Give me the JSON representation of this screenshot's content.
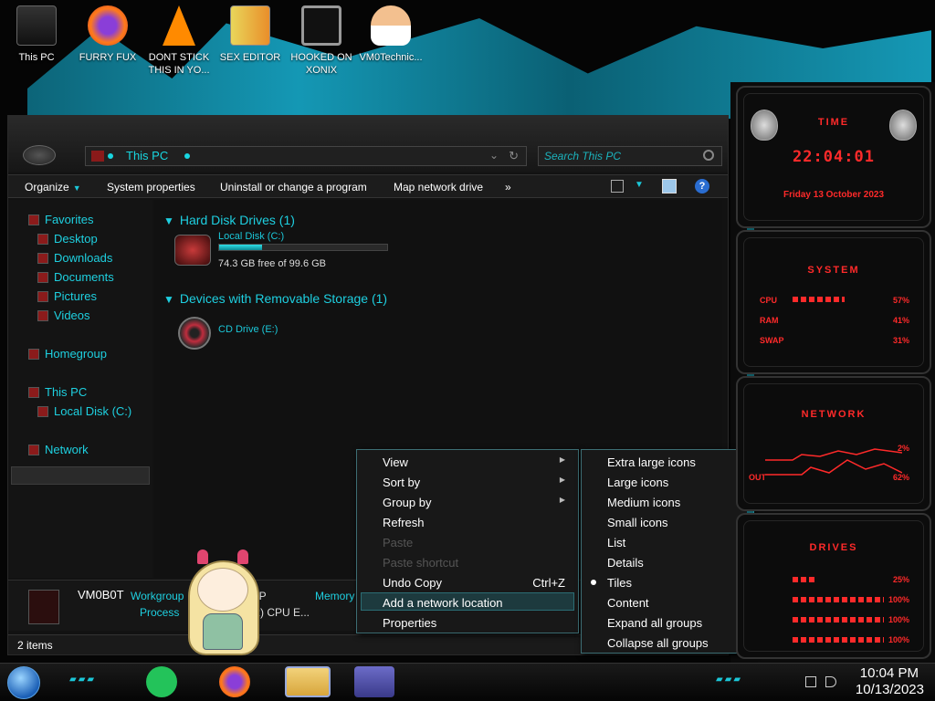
{
  "desktop_icons": [
    {
      "label": "This PC",
      "icon": "computer-icon"
    },
    {
      "label": "FURRY FUX",
      "icon": "firefox-icon"
    },
    {
      "label": "DONT STICK THIS IN YO...",
      "icon": "vlc-icon"
    },
    {
      "label": "SEX EDITOR",
      "icon": "hex-editor-icon"
    },
    {
      "label": "HOOKED ON XONIX",
      "icon": "xonix-game-icon"
    },
    {
      "label": "VM0Technic...",
      "icon": "doctor-icon"
    }
  ],
  "explorer": {
    "address": "This PC",
    "search_placeholder": "Search This PC",
    "toolbar": {
      "organize": "Organize",
      "system_properties": "System properties",
      "uninstall": "Uninstall or change a program",
      "map_drive": "Map network drive",
      "more": "»"
    },
    "nav": {
      "favorites": "Favorites",
      "desktop": "Desktop",
      "downloads": "Downloads",
      "documents": "Documents",
      "pictures": "Pictures",
      "videos": "Videos",
      "homegroup": "Homegroup",
      "this_pc": "This PC",
      "local_disk": "Local Disk (C:)",
      "network": "Network"
    },
    "groups": {
      "hard_disk": "Hard Disk Drives (1)",
      "removable": "Devices with Removable Storage (1)"
    },
    "drive_c": {
      "name": "Local Disk (C:)",
      "free": "74.3 GB free of 99.6 GB",
      "used_fraction": 0.254
    },
    "drive_e": {
      "name": "CD Drive (E:)"
    },
    "details": {
      "computer_name": "VM0B0T",
      "workgroup_label": "Workgroup",
      "workgroup_value": "UP",
      "memory_label": "Memory",
      "processor_label": "Process",
      "processor_value": "on(R) CPU E..."
    },
    "status": "2 items"
  },
  "context_menu": {
    "items": [
      {
        "label": "View",
        "submenu": true
      },
      {
        "label": "Sort by",
        "submenu": true
      },
      {
        "label": "Group by",
        "submenu": true
      },
      {
        "label": "Refresh"
      },
      {
        "label": "Paste",
        "disabled": true
      },
      {
        "label": "Paste shortcut",
        "disabled": true
      },
      {
        "label": "Undo Copy",
        "shortcut": "Ctrl+Z"
      },
      {
        "label": "Add a network location",
        "highlighted": true
      },
      {
        "label": "Properties"
      }
    ]
  },
  "view_submenu": {
    "items": [
      "Extra large icons",
      "Large icons",
      "Medium icons",
      "Small icons",
      "List",
      "Details",
      "Tiles",
      "Content",
      "Expand all groups",
      "Collapse all groups"
    ],
    "selected": "Tiles"
  },
  "gadgets": {
    "time_title": "TIME",
    "clock": "22:04:01",
    "date": "Friday 13 October 2023",
    "system_title": "SYSTEM",
    "cpu_label": "CPU",
    "cpu_value": "57%",
    "ram_label": "RAM",
    "ram_value": "41%",
    "swap_label": "SWAP",
    "swap_value": "31%",
    "network_title": "NETWORK",
    "net_in_value": "2%",
    "net_out_label": "OUT",
    "net_out_value": "62%",
    "drives_title": "DRIVES",
    "drive_values": [
      "25%",
      "100%",
      "100%",
      "100%"
    ]
  },
  "taskbar": {
    "time": "10:04 PM",
    "date": "10/13/2023"
  },
  "colors": {
    "accent": "#1ecfe0",
    "gadget_red": "#ff2a2a"
  }
}
